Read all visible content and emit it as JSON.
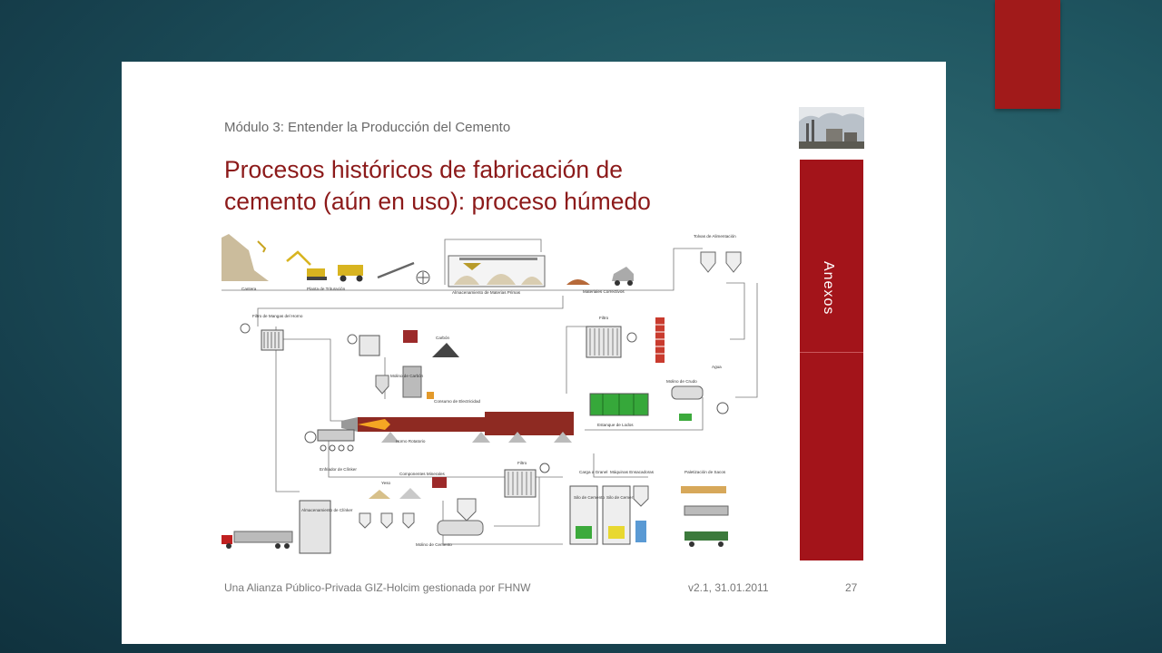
{
  "module_label": "Módulo 3: Entender la Producción del Cemento",
  "title_line1": "Procesos históricos de fabricación de",
  "title_line2": "cemento (aún en uso): proceso húmedo",
  "sidebar_label": "Anexos",
  "footer": {
    "left": "Una Alianza Público-Privada GIZ-Holcim gestionada por FHNW",
    "version": "v2.1, 31.01.2011",
    "page": "27"
  },
  "diagram": {
    "labels": {
      "cantera": "Cantera",
      "trituradora": "Planta de Trituración",
      "almacenamiento": "Almacenamiento de Materias Primas",
      "materiales_correctivos": "Materiales Correctivos",
      "tolvas": "Tolvas de Alimentación",
      "filtro_mangas": "Filtro de Mangas del Horno",
      "carbon": "Carbón",
      "molino_carbon": "Molino de Carbón",
      "consumo_electricidad": "Consumo de Electricidad",
      "filtro": "Filtro",
      "molino_crudo": "Molino de Crudo",
      "agua": "Agua",
      "horno": "Horno Rotatorio",
      "estanque_lodos": "Estanque de Lodos",
      "enfriador": "Enfriador de Clínker",
      "silo_clinker": "Almacenamiento de Clínker",
      "yeso": "Yeso",
      "componentes_minerales": "Componentes Minerales",
      "filtro2": "Filtro",
      "molino_cemento": "Molino de Cemento",
      "silos_cemento": "Silo de Cemento",
      "carga_granel": "Carga a Granel",
      "maquinas_ensacadoras": "Máquinas Ensacadoras",
      "paletizacion": "Paletización de Sacos"
    }
  }
}
